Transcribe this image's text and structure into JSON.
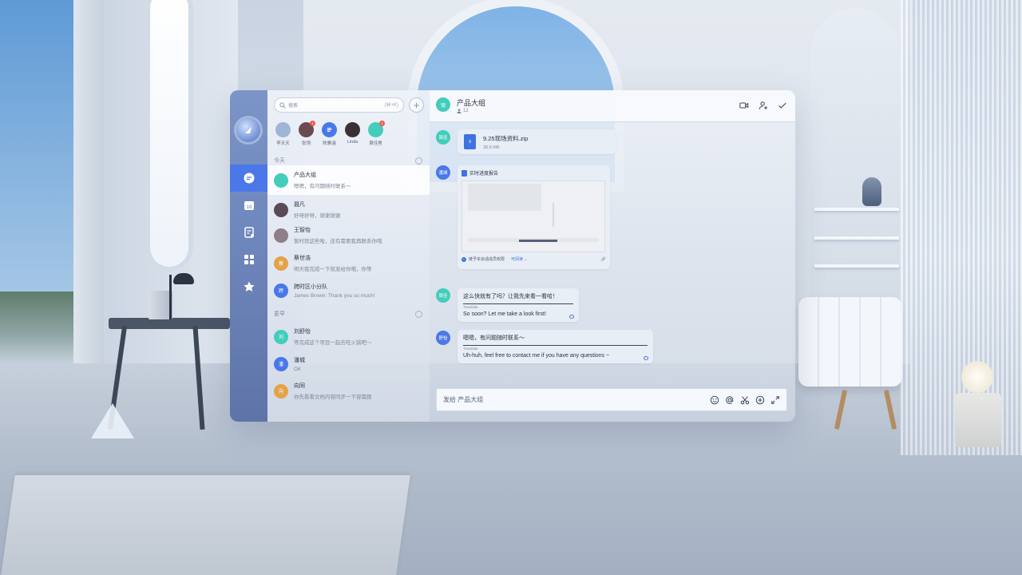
{
  "colors": {
    "rail": "#6f88bd",
    "accent": "#4a78e8",
    "file_blue": "#3f72e3",
    "badge_red": "#f1554b"
  },
  "search": {
    "placeholder": "搜索",
    "shortcut": "(⌘+K)"
  },
  "rail": {
    "items": [
      {
        "name": "chat",
        "icon": "chat-bubble-icon",
        "active": true
      },
      {
        "name": "calendar",
        "icon": "calendar-icon",
        "label": "18"
      },
      {
        "name": "docs",
        "icon": "document-icon"
      },
      {
        "name": "apps",
        "icon": "grid-icon"
      },
      {
        "name": "favorites",
        "icon": "star-icon"
      }
    ]
  },
  "contacts": [
    {
      "name": "李天天",
      "color": "#9fb5d6"
    },
    {
      "name": "张翎",
      "color": "#6b4a52",
      "badge": "1"
    },
    {
      "name": "陈雅涵",
      "color": "#4a78e8"
    },
    {
      "name": "Linda",
      "color": "#3b3036"
    },
    {
      "name": "周佳男",
      "color": "#43cdbb",
      "badge": "2"
    }
  ],
  "sections": {
    "today": "今天",
    "earlier": "更早"
  },
  "conversations": [
    {
      "title": "产品大组",
      "preview": "嗯嗯，有问题随时联系～",
      "avatar": "",
      "color": "#43cdbb",
      "active": true
    },
    {
      "title": "聂凡",
      "preview": "好呀好呀，谢谢谢谢",
      "avatar": "",
      "color": "#5a4a56"
    },
    {
      "title": "王智怡",
      "preview": "暂时就这些啦，还有需要我再联系你哦",
      "avatar": "",
      "color": "#8e7f86"
    },
    {
      "title": "蔡世浩",
      "preview": "明天我完成一下就发给你哦，你等",
      "avatar": "蔡",
      "color": "#e5a24a"
    },
    {
      "title": "跨时区小分队",
      "preview": "James Brown: Thank you so much!",
      "avatar": "跨",
      "color": "#4a78e8"
    },
    {
      "title": "刘舒怡",
      "preview": "等完成这个项目一起去吃火锅吧～",
      "avatar": "刘",
      "color": "#43cdbb"
    },
    {
      "title": "潘城",
      "preview": "OK",
      "avatar": "潘",
      "color": "#4a78e8"
    },
    {
      "title": "向同",
      "preview": "你先看看文档内容同步一下容需跟",
      "avatar": "向",
      "color": "#e5a24a"
    }
  ],
  "chat": {
    "title": "产品大组",
    "members": "12",
    "avatar": "镇",
    "file": {
      "sender": "周佳",
      "name": "9.25现场资料.zip",
      "size": "38.8 MB"
    },
    "doc": {
      "sender": "潘城",
      "title": "实时进度报告",
      "notice": "链予本会话成员权限",
      "perm": "可阅读"
    },
    "messages": [
      {
        "sender": "周佳",
        "text": "这么快就有了吗？让我先来看一看哈！",
        "translate_label": "Translate",
        "translation": "So soon? Let me take a look first!"
      },
      {
        "sender": "舒怡",
        "text": "嗯嗯，有问题随时联系～",
        "translate_label": "Translate",
        "translation": "Uh-huh, feel free to contact me if you have any questions ~"
      }
    ],
    "input_placeholder": "发给 产品大组"
  }
}
